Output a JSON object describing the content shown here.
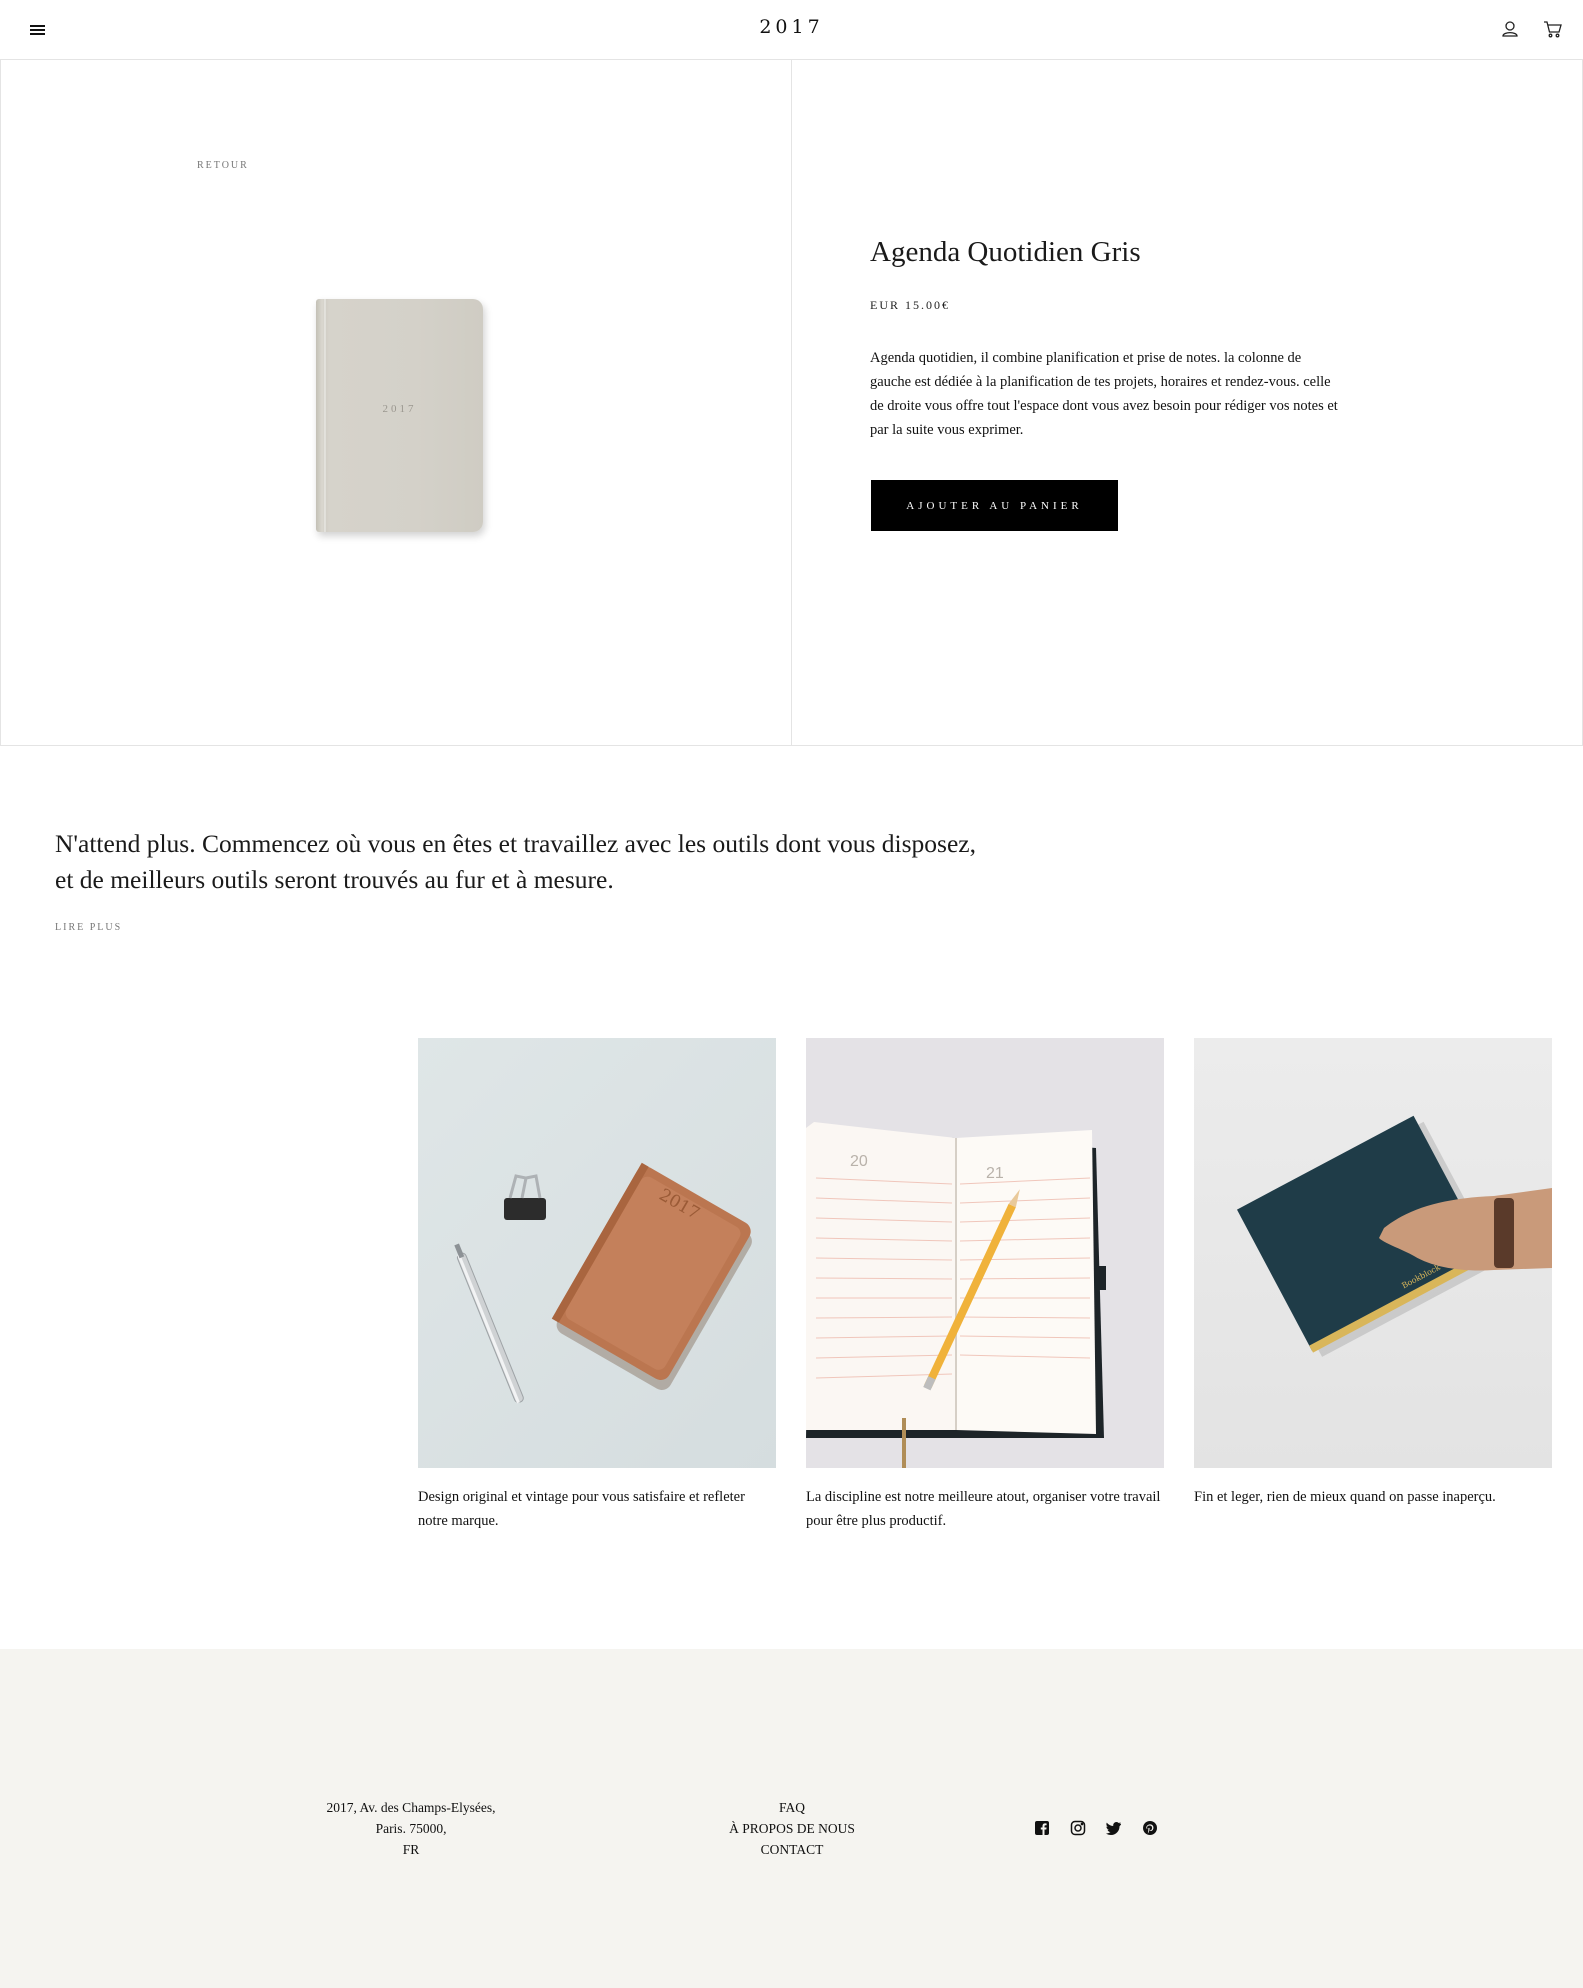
{
  "header": {
    "logo": "2017",
    "menu_icon": "hamburger-menu-icon",
    "account_icon": "user-icon",
    "cart_icon": "shopping-cart-icon"
  },
  "product": {
    "back_label": "RETOUR",
    "image_year": "2017",
    "title": "Agenda Quotidien Gris",
    "price": "EUR 15.00€",
    "description": "Agenda quotidien, il combine planification et prise de notes. la colonne de gauche est dédiée à la planification de tes projets, horaires et rendez-vous. celle de droite vous offre tout l'espace dont vous avez besoin pour rédiger vos notes et par la suite vous exprimer.",
    "add_to_cart_label": "AJOUTER AU PANIER"
  },
  "quote": {
    "line1": "N'attend plus. Commencez où vous en êtes et travaillez avec les outils dont vous disposez,",
    "line2": "et de meilleurs outils seront trouvés au fur et à mesure.",
    "read_more_label": "LIRE PLUS"
  },
  "gallery": [
    {
      "caption": "Design original et vintage pour vous satisfaire et refleter notre marque.",
      "image_year": "2017"
    },
    {
      "caption": "La discipline est notre meilleure atout, organiser votre travail pour être plus productif.",
      "page_left": "20",
      "page_right": "21"
    },
    {
      "caption": "Fin et leger, rien de mieux quand on passe inaperçu.",
      "cover_text": "Bookblock"
    }
  ],
  "footer": {
    "address_line1": "2017, Av. des Champs-Elysées,",
    "address_line2": "Paris. 75000,",
    "address_line3": "FR",
    "links": [
      "FAQ",
      "À PROPOS DE NOUS",
      "CONTACT"
    ],
    "social": [
      "facebook-icon",
      "instagram-icon",
      "twitter-icon",
      "pinterest-icon"
    ]
  },
  "colors": {
    "button_bg": "#000000",
    "footer_bg": "#f5f4f0",
    "border": "#e4e4e4"
  }
}
